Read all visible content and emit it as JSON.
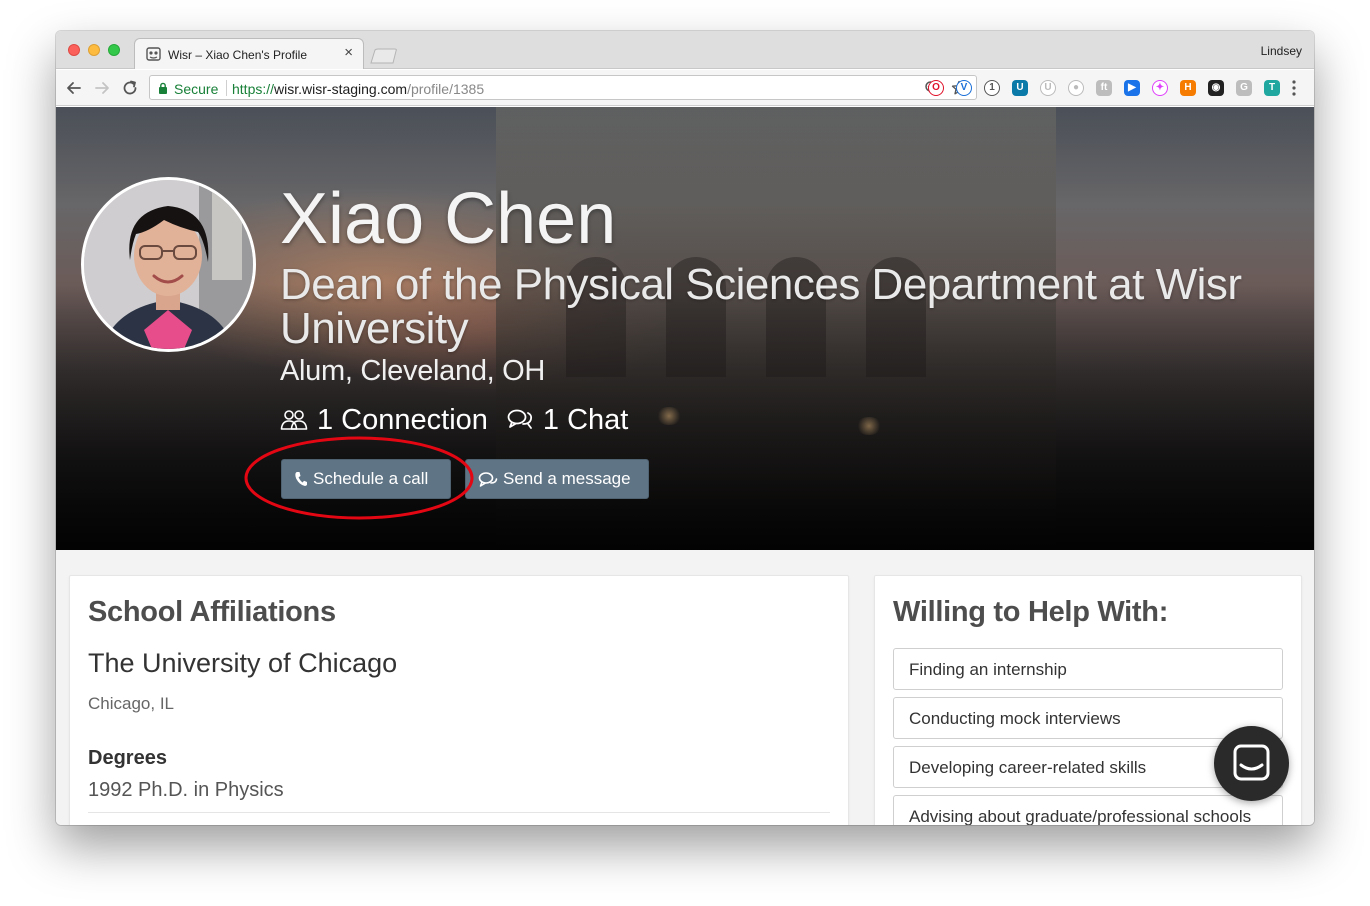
{
  "browser": {
    "tab_title": "Wisr – Xiao Chen's Profile",
    "tab_close": "×",
    "profile_name": "Lindsey",
    "secure_label": "Secure",
    "url_scheme": "https://",
    "url_host": "wisr.wisr-staging.com",
    "url_path": "/profile/1385",
    "icons": [
      "back-icon",
      "forward-icon",
      "reload-icon",
      "lock-icon",
      "zoom-icon",
      "star-icon",
      "menu-icon"
    ]
  },
  "extensions": [
    {
      "name": "opera-extension",
      "color": "#ffffff",
      "fg": "#e0122b",
      "glyph": "O"
    },
    {
      "name": "vimeo-extension",
      "color": "#ffffff",
      "fg": "#1a6fd8",
      "glyph": "V"
    },
    {
      "name": "one-password-extension",
      "color": "#ffffff",
      "fg": "#555555",
      "glyph": "1"
    },
    {
      "name": "ublock-extension",
      "color": "#0b7aa8",
      "fg": "#ffffff",
      "glyph": "U"
    },
    {
      "name": "disabled-extension-1",
      "color": "#ffffff",
      "fg": "#bbbbbb",
      "glyph": "U"
    },
    {
      "name": "disabled-extension-2",
      "color": "#ffffff",
      "fg": "#bbbbbb",
      "glyph": "●"
    },
    {
      "name": "disabled-extension-3",
      "color": "#bdbdbd",
      "fg": "#ffffff",
      "glyph": "ft"
    },
    {
      "name": "arrow-extension",
      "color": "#1a73e8",
      "fg": "#ffffff",
      "glyph": "▶"
    },
    {
      "name": "color-wheel-extension",
      "color": "#ffffff",
      "fg": "#e040fb",
      "glyph": "✦"
    },
    {
      "name": "hubspot-extension",
      "color": "#f57c00",
      "fg": "#ffffff",
      "glyph": "H"
    },
    {
      "name": "camera-extension",
      "color": "#222222",
      "fg": "#ffffff",
      "glyph": "◉"
    },
    {
      "name": "grammarly-extension",
      "color": "#bdbdbd",
      "fg": "#ffffff",
      "glyph": "G"
    },
    {
      "name": "tab-extension",
      "color": "#1fa7a0",
      "fg": "#ffffff",
      "glyph": "T"
    }
  ],
  "profile": {
    "name": "Xiao Chen",
    "headline": "Dean of the Physical Sciences Department at Wisr University",
    "location": "Alum, Cleveland, OH",
    "connections": "1 Connection",
    "chats": "1 Chat",
    "schedule_button": "Schedule a call",
    "message_button": "Send a message",
    "annotation_color": "#e30613",
    "button_color": "#5f7485"
  },
  "affiliations": {
    "title": "School Affiliations",
    "school": "The University of Chicago",
    "city": "Chicago, IL",
    "degrees_label": "Degrees",
    "degree": "1992 Ph.D. in Physics"
  },
  "help": {
    "title": "Willing to Help With:",
    "items": [
      "Finding an internship",
      "Conducting mock interviews",
      "Developing career-related skills",
      "Advising about graduate/professional schools"
    ]
  }
}
